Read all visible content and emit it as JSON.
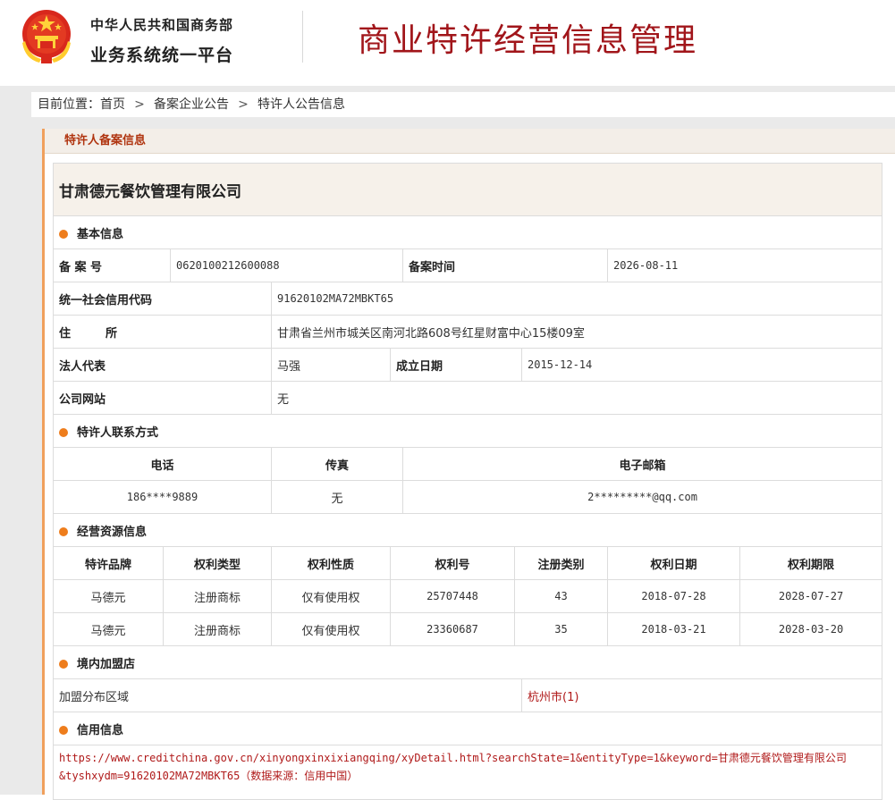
{
  "header": {
    "ministry": "中华人民共和国商务部",
    "platform": "业务系统统一平台",
    "system_title": "商业特许经营信息管理",
    "colors": {
      "title_red": "#a1151a",
      "accent_orange": "#ee7d1c",
      "link_red": "#b01a1a"
    }
  },
  "breadcrumb": {
    "prefix": "目前位置：",
    "items": [
      "首页",
      "备案企业公告",
      "特许人公告信息"
    ],
    "separator": ">"
  },
  "panel": {
    "title": "特许人备案信息"
  },
  "company": {
    "name": "甘肃德元餐饮管理有限公司"
  },
  "basic_info": {
    "section_title": "基本信息",
    "record_no_label": "备 案 号",
    "record_no": "0620100212600088",
    "record_time_label": "备案时间",
    "record_time": "2026-08-11",
    "credit_code_label": "统一社会信用代码",
    "credit_code": "91620102MA72MBKT65",
    "address_label": "住　　　所",
    "address": "甘肃省兰州市城关区南河北路608号红星财富中心15楼09室",
    "legal_rep_label": "法人代表",
    "legal_rep": "马强",
    "founded_label": "成立日期",
    "founded": "2015-12-14",
    "website_label": "公司网站",
    "website": "无"
  },
  "contact": {
    "section_title": "特许人联系方式",
    "headers": [
      "电话",
      "传真",
      "电子邮箱"
    ],
    "phone": "186****9889",
    "fax": "无",
    "email": "2*********@qq.com"
  },
  "resources": {
    "section_title": "经营资源信息",
    "headers": [
      "特许品牌",
      "权利类型",
      "权利性质",
      "权利号",
      "注册类别",
      "权利日期",
      "权利期限"
    ],
    "rows": [
      [
        "马德元",
        "注册商标",
        "仅有使用权",
        "25707448",
        "43",
        "2018-07-28",
        "2028-07-27"
      ],
      [
        "马德元",
        "注册商标",
        "仅有使用权",
        "23360687",
        "35",
        "2018-03-21",
        "2028-03-20"
      ]
    ]
  },
  "domestic_stores": {
    "section_title": "境内加盟店",
    "region_label": "加盟分布区域",
    "region_link": "杭州市(1)"
  },
  "credit": {
    "section_title": "信用信息",
    "url_text": "https://www.creditchina.gov.cn/xinyongxinxixiangqing/xyDetail.html?searchState=1&entityType=1&keyword=甘肃德元餐饮管理有限公司&tyshxydm=91620102MA72MBKT65（数据来源：信用中国）"
  }
}
